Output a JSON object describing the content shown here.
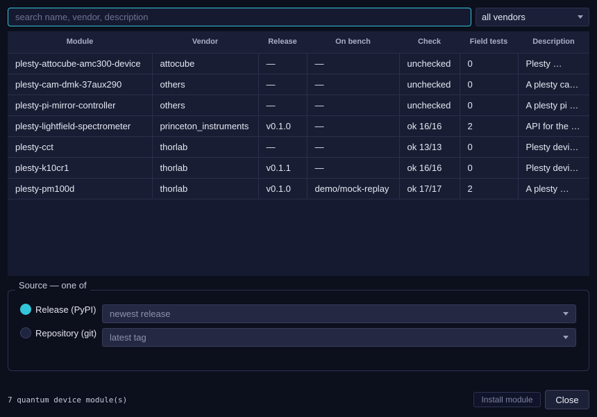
{
  "search": {
    "placeholder": "search name, vendor, description",
    "value": ""
  },
  "vendor_filter": {
    "selected": "all vendors"
  },
  "table": {
    "headers": [
      "Module",
      "Vendor",
      "Release",
      "On bench",
      "Check",
      "Field tests",
      "Description"
    ],
    "rows": [
      [
        "plesty-attocube-amc300-device",
        "attocube",
        "—",
        "—",
        "unchecked",
        "0",
        "Plesty …"
      ],
      [
        "plesty-cam-dmk-37aux290",
        "others",
        "—",
        "—",
        "unchecked",
        "0",
        "A plesty ca…"
      ],
      [
        "plesty-pi-mirror-controller",
        "others",
        "—",
        "—",
        "unchecked",
        "0",
        "A plesty pi …"
      ],
      [
        "plesty-lightfield-spectrometer",
        "princeton_instruments",
        "v0.1.0",
        "—",
        "ok 16/16",
        "2",
        "API for the …"
      ],
      [
        "plesty-cct",
        "thorlab",
        "—",
        "—",
        "ok 13/13",
        "0",
        "Plesty devi…"
      ],
      [
        "plesty-k10cr1",
        "thorlab",
        "v0.1.1",
        "—",
        "ok 16/16",
        "0",
        "Plesty devi…"
      ],
      [
        "plesty-pm100d",
        "thorlab",
        "v0.1.0",
        "demo/mock-replay",
        "ok 17/17",
        "2",
        "A plesty …"
      ]
    ]
  },
  "source": {
    "legend": "Source — one of",
    "release": {
      "label": "Release (PyPI)",
      "selected": true,
      "combo_value": "newest release"
    },
    "repository": {
      "label": "Repository (git)",
      "selected": false,
      "combo_value": "latest tag"
    }
  },
  "footer": {
    "status": "7 quantum device module(s)",
    "install_label": "Install module",
    "close_label": "Close"
  },
  "colors": {
    "accent": "#33c6da",
    "background": "#0c0f1c"
  },
  "icons": {
    "dropdown": "chevron-down-icon"
  }
}
